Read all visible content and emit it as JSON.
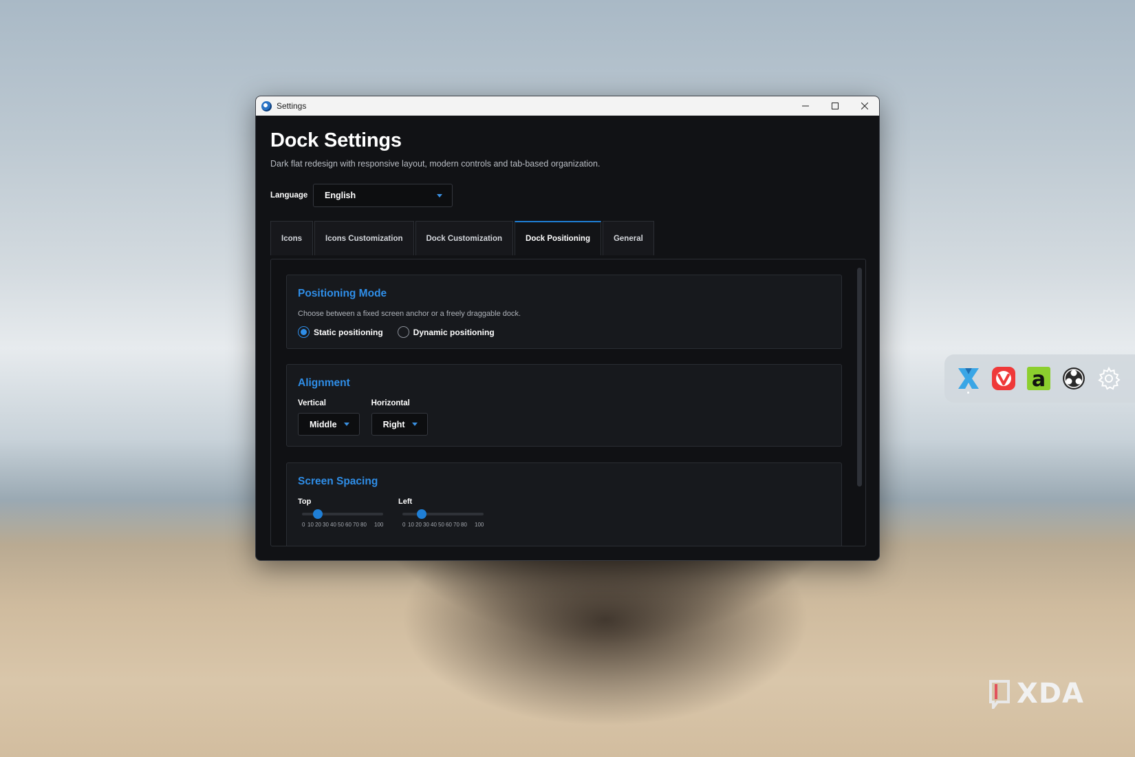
{
  "window": {
    "title": "Settings",
    "controls": {
      "minimize": "–",
      "maximize": "☐",
      "close": "✕"
    }
  },
  "page": {
    "title": "Dock Settings",
    "subtitle": "Dark flat redesign with responsive layout, modern controls and tab-based organization."
  },
  "language": {
    "label": "Language",
    "value": "English"
  },
  "tabs": [
    {
      "label": "Icons",
      "active": false
    },
    {
      "label": "Icons Customization",
      "active": false
    },
    {
      "label": "Dock Customization",
      "active": false
    },
    {
      "label": "Dock Positioning",
      "active": true
    },
    {
      "label": "General",
      "active": false
    }
  ],
  "positioning_mode": {
    "title": "Positioning Mode",
    "description": "Choose between a fixed screen anchor or a freely draggable dock.",
    "options": [
      {
        "label": "Static positioning",
        "checked": true
      },
      {
        "label": "Dynamic positioning",
        "checked": false
      }
    ]
  },
  "alignment": {
    "title": "Alignment",
    "vertical": {
      "label": "Vertical",
      "value": "Middle"
    },
    "horizontal": {
      "label": "Horizontal",
      "value": "Right"
    }
  },
  "screen_spacing": {
    "title": "Screen Spacing",
    "sliders": [
      {
        "label": "Top",
        "value": 15
      },
      {
        "label": "Left",
        "value": 20
      }
    ],
    "ticks": [
      "0",
      "10",
      "20",
      "30",
      "40",
      "50",
      "60",
      "70",
      "80",
      "100"
    ]
  },
  "dock": {
    "icons": [
      "x-app-icon",
      "vivaldi-icon",
      "a-app-icon",
      "obs-icon",
      "gear-icon"
    ],
    "colors": {
      "x": "#3aa6e6",
      "vivaldi": "#ef3939",
      "a": "#8ccf2e",
      "obs": "#2a2a2a",
      "gear": "#ffffff"
    }
  },
  "watermark": {
    "text": "XDA"
  }
}
